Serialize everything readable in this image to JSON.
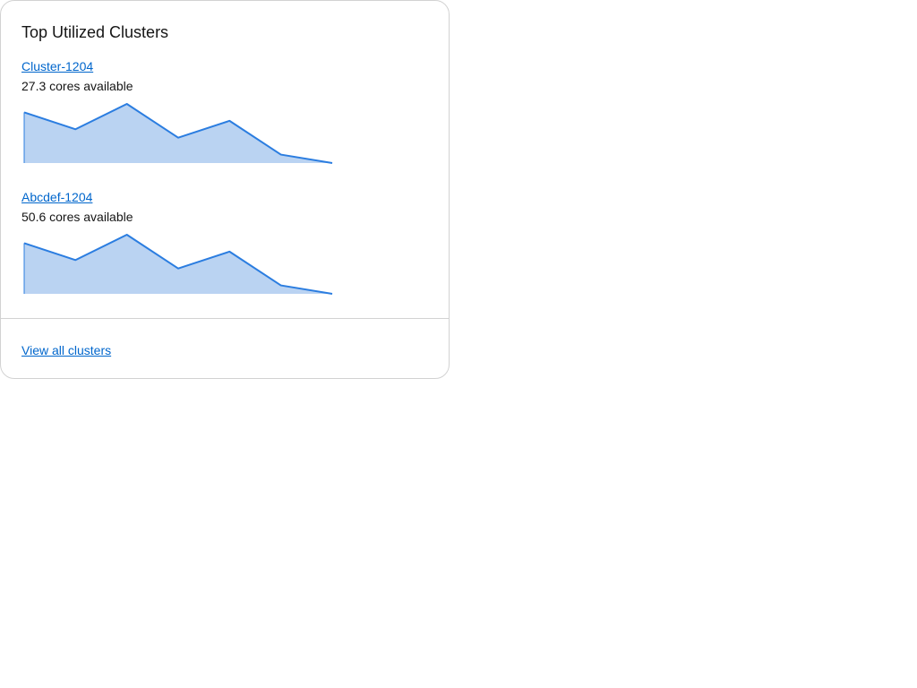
{
  "card": {
    "title": "Top Utilized Clusters",
    "footer_link": "View all clusters"
  },
  "clusters": [
    {
      "name": "Cluster-1204",
      "availability": "27.3 cores available",
      "trend": [
        6,
        4,
        7,
        3,
        5,
        1,
        0
      ]
    },
    {
      "name": "Abcdef-1204",
      "availability": "50.6 cores available",
      "trend": [
        6,
        4,
        7,
        3,
        5,
        1,
        0
      ]
    }
  ],
  "colors": {
    "link": "#0066cc",
    "sparkline_stroke": "#2b7de0",
    "sparkline_fill": "#bad3f2",
    "border": "#d2d2d2"
  }
}
